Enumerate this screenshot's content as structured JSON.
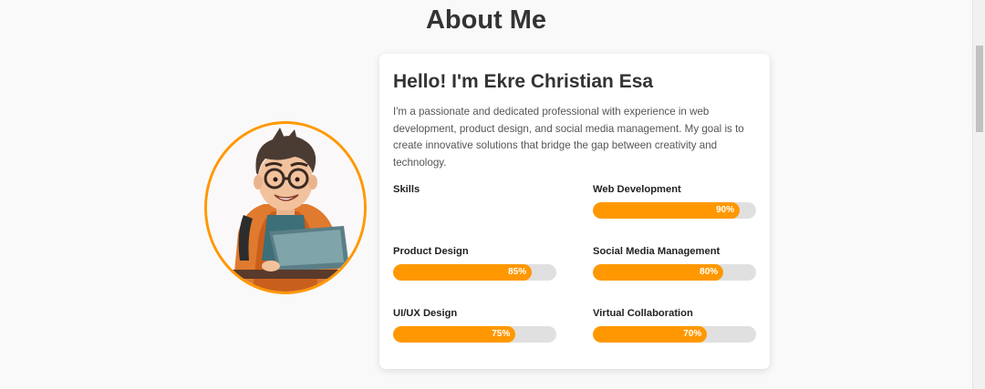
{
  "section": {
    "title": "About Me"
  },
  "about": {
    "heading": "Hello! I'm Ekre Christian Esa",
    "description": "I'm a passionate and dedicated professional with experience in web development, product design, and social media management. My goal is to create innovative solutions that bridge the gap between creativity and technology."
  },
  "skills": {
    "header": "Skills",
    "items": [
      {
        "name": "Web Development",
        "percent_label": "90%",
        "value": 90
      },
      {
        "name": "Product Design",
        "percent_label": "85%",
        "value": 85
      },
      {
        "name": "Social Media Management",
        "percent_label": "80%",
        "value": 80
      },
      {
        "name": "UI/UX Design",
        "percent_label": "75%",
        "value": 75
      },
      {
        "name": "Virtual Collaboration",
        "percent_label": "70%",
        "value": 70
      }
    ]
  },
  "colors": {
    "accent": "#ff9800",
    "track": "#e0e0e0",
    "background": "#f9f9f9"
  },
  "avatar": {
    "icon": "developer-avatar-illustration"
  }
}
